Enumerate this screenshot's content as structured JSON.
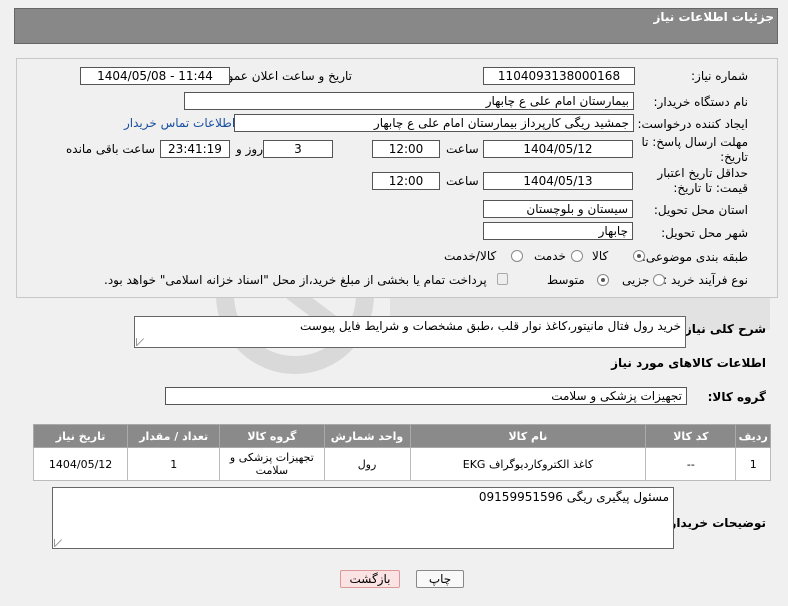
{
  "header": {
    "title": "جزئیات اطلاعات نیاز"
  },
  "fields": {
    "need_number_label": "شماره نیاز:",
    "need_number": "1104093138000168",
    "announce_label": "تاریخ و ساعت اعلان عمومی:",
    "announce_value": "1404/05/08 - 11:44",
    "buyer_org_label": "نام دستگاه خریدار:",
    "buyer_org": "بیمارستان امام علی  ع  چابهار",
    "creator_label": "ایجاد کننده درخواست:",
    "creator": "جمشید ریگی کارپرداز بیمارستان امام علی  ع  چابهار",
    "contact_link": "اطلاعات تماس خریدار",
    "deadline_label": "مهلت ارسال پاسخ: تا تاریخ:",
    "deadline_date": "1404/05/12",
    "hour_label": "ساعت",
    "deadline_time": "12:00",
    "days_value": "3",
    "days_label": "روز و",
    "remaining_time": "23:41:19",
    "remaining_label": "ساعت باقی مانده",
    "price_validity_label": "حداقل تاریخ اعتبار قیمت: تا تاریخ:",
    "price_date": "1404/05/13",
    "price_time": "12:00",
    "province_label": "استان محل تحویل:",
    "province": "سیستان و بلوچستان",
    "city_label": "شهر محل تحویل:",
    "city": "چابهار",
    "category_label": "طبقه بندی موضوعی:",
    "category_options": [
      "کالا",
      "خدمت",
      "کالا/خدمت"
    ],
    "process_label": "نوع فرآیند خرید :",
    "process_options": [
      "جزیی",
      "متوسط"
    ],
    "payment_note": "پرداخت تمام یا بخشی از مبلغ خرید،از محل \"اسناد خزانه اسلامی\" خواهد بود."
  },
  "description": {
    "label": "شرح کلی نیاز:",
    "text": "خرید رول فتال مانیتور،کاغذ نوار قلب ،طبق مشخصات و شرایط فایل پیوست"
  },
  "goods": {
    "section_title": "اطلاعات کالاهای مورد نیاز",
    "group_label": "گروه کالا:",
    "group_value": "تجهیزات پزشکی و سلامت",
    "columns": [
      "ردیف",
      "کد کالا",
      "نام کالا",
      "واحد شمارش",
      "گروه کالا",
      "تعداد / مقدار",
      "تاریخ نیاز"
    ],
    "rows": [
      [
        "1",
        "--",
        "کاغذ الکتروکاردیوگراف EKG",
        "رول",
        "تجهیزات پزشکی و سلامت",
        "1",
        "1404/05/12"
      ]
    ]
  },
  "buyer_notes": {
    "label": "توضیحات خریدار:",
    "text": "مسئول پیگیری ریگی 09159951596"
  },
  "buttons": {
    "print": "چاپ",
    "back": "بازگشت"
  }
}
